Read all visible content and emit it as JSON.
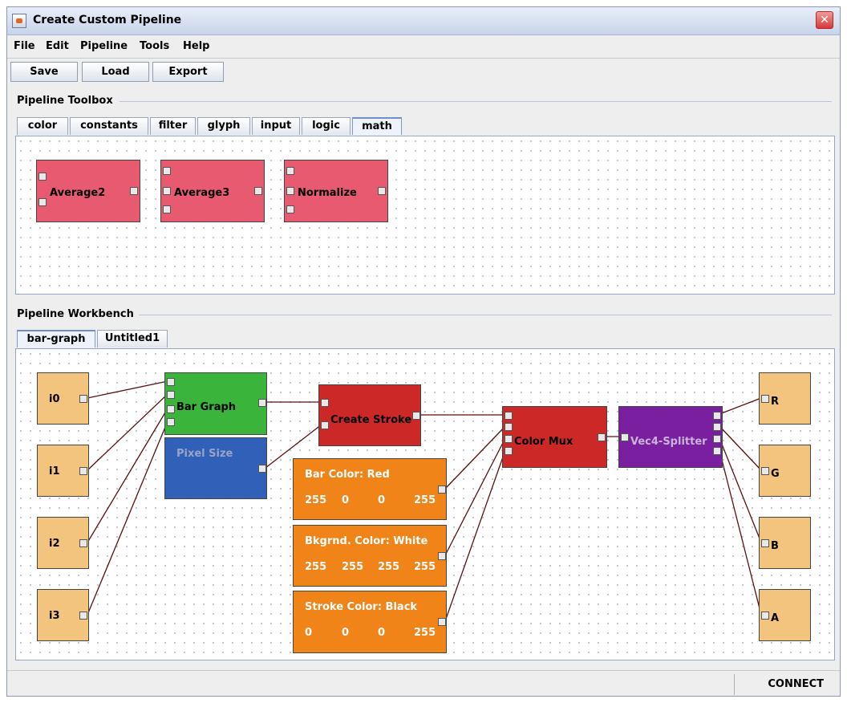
{
  "window": {
    "title": "Create Custom Pipeline",
    "close_glyph": "✕"
  },
  "menu": {
    "file": "File",
    "edit": "Edit",
    "pipeline": "Pipeline",
    "tools": "Tools",
    "help": "Help"
  },
  "toolbar": {
    "save": "Save",
    "load": "Load",
    "export": "Export"
  },
  "toolbox": {
    "title": "Pipeline Toolbox",
    "tabs": [
      "color",
      "constants",
      "filter",
      "glyph",
      "input",
      "logic",
      "math"
    ],
    "active_tab": "math",
    "nodes": [
      "Average2",
      "Average3",
      "Normalize"
    ]
  },
  "workbench": {
    "title": "Pipeline Workbench",
    "tabs": [
      "bar-graph",
      "Untitled1"
    ],
    "active_tab": "bar-graph",
    "inputs": [
      "i0",
      "i1",
      "i2",
      "i3"
    ],
    "outputs": [
      "R",
      "G",
      "B",
      "A"
    ],
    "bar_graph": "Bar Graph",
    "pixel_size": "Pixel Size",
    "create_stroke": "Create Stroke",
    "color_mux": "Color Mux",
    "splitter": "Vec4-Splitter",
    "bar_color": {
      "label": "Bar Color: Red",
      "values": [
        "255",
        "0",
        "0",
        "255"
      ]
    },
    "bkgrnd_color": {
      "label": "Bkgrnd. Color: White",
      "values": [
        "255",
        "255",
        "255",
        "255"
      ]
    },
    "stroke_color": {
      "label": "Stroke Color: Black",
      "values": [
        "0",
        "0",
        "0",
        "255"
      ]
    }
  },
  "colors": {
    "math_node": "#e85a70",
    "input_node": "#f2c47e",
    "bar_graph": "#3ab43a",
    "pixel_size": "#3060b8",
    "create_stroke": "#cc2828",
    "color_mux": "#cc2828",
    "splitter": "#7a1fa0",
    "color_node": "#f08418"
  },
  "status": {
    "text": "CONNECT"
  }
}
